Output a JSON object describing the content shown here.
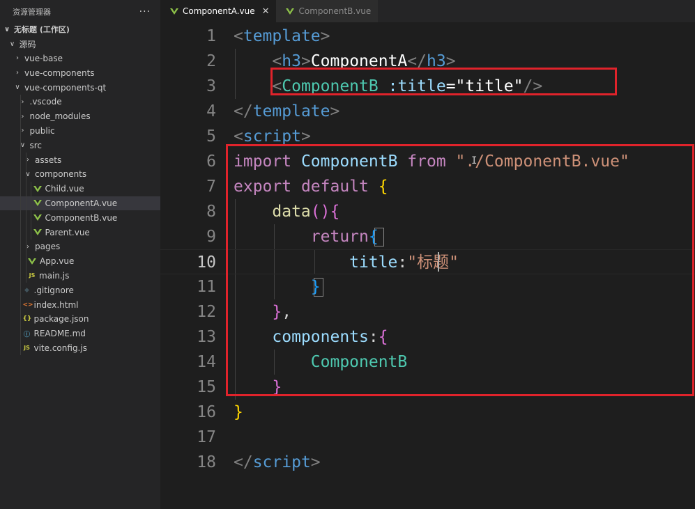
{
  "sidebar": {
    "title": "资源管理器",
    "more": "···",
    "workspace": "无标题 (工作区)",
    "tree": [
      {
        "label": "源码",
        "depth": 1,
        "type": "folder",
        "open": true
      },
      {
        "label": "vue-base",
        "depth": 2,
        "type": "folder",
        "open": false
      },
      {
        "label": "vue-components",
        "depth": 2,
        "type": "folder",
        "open": false
      },
      {
        "label": "vue-components-qt",
        "depth": 2,
        "type": "folder",
        "open": true
      },
      {
        "label": ".vscode",
        "depth": 3,
        "type": "folder",
        "open": false
      },
      {
        "label": "node_modules",
        "depth": 3,
        "type": "folder",
        "open": false
      },
      {
        "label": "public",
        "depth": 3,
        "type": "folder",
        "open": false
      },
      {
        "label": "src",
        "depth": 3,
        "type": "folder",
        "open": true
      },
      {
        "label": "assets",
        "depth": 4,
        "type": "folder",
        "open": false
      },
      {
        "label": "components",
        "depth": 4,
        "type": "folder",
        "open": true
      },
      {
        "label": "Child.vue",
        "depth": 5,
        "type": "vue"
      },
      {
        "label": "ComponentA.vue",
        "depth": 5,
        "type": "vue",
        "selected": true
      },
      {
        "label": "ComponentB.vue",
        "depth": 5,
        "type": "vue"
      },
      {
        "label": "Parent.vue",
        "depth": 5,
        "type": "vue"
      },
      {
        "label": "pages",
        "depth": 4,
        "type": "folder",
        "open": false
      },
      {
        "label": "App.vue",
        "depth": 4,
        "type": "vue"
      },
      {
        "label": "main.js",
        "depth": 4,
        "type": "js"
      },
      {
        "label": ".gitignore",
        "depth": 3,
        "type": "git"
      },
      {
        "label": "index.html",
        "depth": 3,
        "type": "html"
      },
      {
        "label": "package.json",
        "depth": 3,
        "type": "json"
      },
      {
        "label": "README.md",
        "depth": 3,
        "type": "md"
      },
      {
        "label": "vite.config.js",
        "depth": 3,
        "type": "js"
      }
    ]
  },
  "tabs": [
    {
      "label": "ComponentA.vue",
      "active": true,
      "close": "✕"
    },
    {
      "label": "ComponentB.vue",
      "active": false
    }
  ],
  "editor": {
    "current_line": 10,
    "lines": [
      {
        "n": "1",
        "tokens": [
          [
            "tg",
            "<"
          ],
          [
            "tn",
            "template"
          ],
          [
            "tg",
            ">"
          ]
        ]
      },
      {
        "n": "2",
        "tokens": [
          [
            "pn",
            "    "
          ],
          [
            "tg",
            "<"
          ],
          [
            "tn",
            "h3"
          ],
          [
            "tg",
            ">"
          ],
          [
            "wt",
            "ComponentA"
          ],
          [
            "tg",
            "</"
          ],
          [
            "tn",
            "h3"
          ],
          [
            "tg",
            ">"
          ]
        ]
      },
      {
        "n": "3",
        "tokens": [
          [
            "pn",
            "    "
          ],
          [
            "tg",
            "<"
          ],
          [
            "cmp",
            "ComponentB"
          ],
          [
            "pn",
            " "
          ],
          [
            "at",
            ":title"
          ],
          [
            "wt",
            "=\"title\""
          ],
          [
            "tg",
            "/>"
          ]
        ]
      },
      {
        "n": "4",
        "tokens": [
          [
            "tg",
            "</"
          ],
          [
            "tn",
            "template"
          ],
          [
            "tg",
            ">"
          ]
        ]
      },
      {
        "n": "5",
        "tokens": [
          [
            "tg",
            "<"
          ],
          [
            "tn",
            "script"
          ],
          [
            "tg",
            ">"
          ]
        ]
      },
      {
        "n": "6",
        "tokens": [
          [
            "kw",
            "import"
          ],
          [
            "pn",
            " "
          ],
          [
            "var",
            "ComponentB"
          ],
          [
            "pn",
            " "
          ],
          [
            "kw",
            "from"
          ],
          [
            "pn",
            " "
          ],
          [
            "st",
            "\"./ComponentB.vue\""
          ]
        ]
      },
      {
        "n": "7",
        "tokens": [
          [
            "kw",
            "export"
          ],
          [
            "pn",
            " "
          ],
          [
            "kw",
            "default"
          ],
          [
            "pn",
            " "
          ],
          [
            "br1",
            "{"
          ]
        ]
      },
      {
        "n": "8",
        "tokens": [
          [
            "pn",
            "    "
          ],
          [
            "fn",
            "data"
          ],
          [
            "br2",
            "()"
          ],
          [
            "br2",
            "{"
          ]
        ]
      },
      {
        "n": "9",
        "tokens": [
          [
            "pn",
            "        "
          ],
          [
            "kw",
            "return"
          ],
          [
            "br3",
            "{"
          ]
        ]
      },
      {
        "n": "10",
        "tokens": [
          [
            "pn",
            "            "
          ],
          [
            "var",
            "title"
          ],
          [
            "pn",
            ":"
          ],
          [
            "st",
            "\"标题\""
          ]
        ]
      },
      {
        "n": "11",
        "tokens": [
          [
            "pn",
            "        "
          ],
          [
            "br3",
            "}"
          ]
        ]
      },
      {
        "n": "12",
        "tokens": [
          [
            "pn",
            "    "
          ],
          [
            "br2",
            "}"
          ],
          [
            "pn",
            ","
          ]
        ]
      },
      {
        "n": "13",
        "tokens": [
          [
            "pn",
            "    "
          ],
          [
            "var",
            "components"
          ],
          [
            "pn",
            ":"
          ],
          [
            "br2",
            "{"
          ]
        ]
      },
      {
        "n": "14",
        "tokens": [
          [
            "pn",
            "        "
          ],
          [
            "cmp",
            "ComponentB"
          ]
        ]
      },
      {
        "n": "15",
        "tokens": [
          [
            "pn",
            "    "
          ],
          [
            "br2",
            "}"
          ]
        ]
      },
      {
        "n": "16",
        "tokens": [
          [
            "br1",
            "}"
          ]
        ]
      },
      {
        "n": "17",
        "tokens": []
      },
      {
        "n": "18",
        "tokens": [
          [
            "tg",
            "</"
          ],
          [
            "tn",
            "script"
          ],
          [
            "tg",
            ">"
          ]
        ]
      }
    ]
  },
  "colors": {
    "highlight_box": "#e0232b",
    "vue_icon": "#8dc149",
    "editor_bg": "#1e1e1e",
    "sidebar_bg": "#252526"
  }
}
